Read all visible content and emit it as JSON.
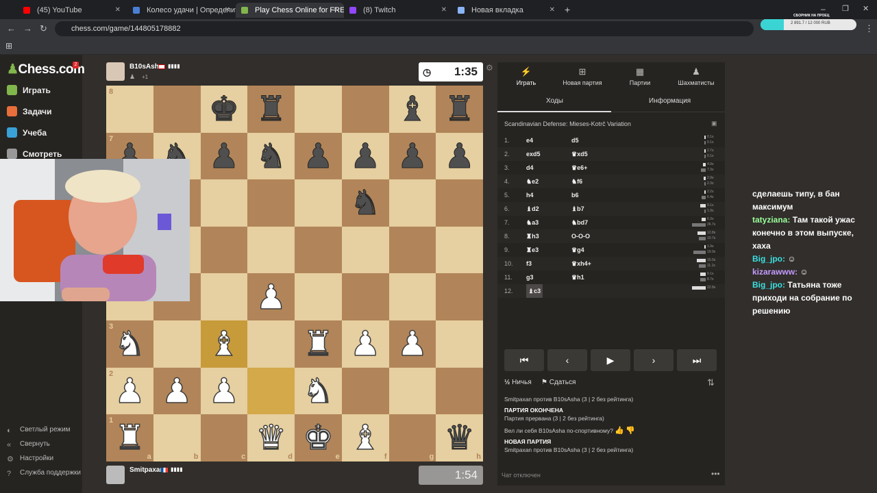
{
  "browser": {
    "tabs": [
      {
        "title": "(45) YouTube",
        "color": "#ff0000"
      },
      {
        "title": "Колесо удачи | Определите п",
        "color": "#4a7fd6"
      },
      {
        "title": "Play Chess Online for FREE - 2 |",
        "color": "#81b64c"
      },
      {
        "title": "(8) Twitch",
        "color": "#9146ff"
      },
      {
        "title": "Новая вкладка",
        "color": "#8ab4f8"
      }
    ],
    "url": "chess.com/game/144805178882",
    "overlay_title": "СБОРНИК НА ПРОЕЦ",
    "overlay_progress_text": "2 891.7 / 12 000 RUB",
    "overlay_progress": 0.24
  },
  "sidebar": {
    "logo": "Chess.com",
    "badge": "2",
    "items": [
      {
        "label": "Играть",
        "color": "#81b64c"
      },
      {
        "label": "Задачи",
        "color": "#e86e3b"
      },
      {
        "label": "Учеба",
        "color": "#3aa0d8"
      },
      {
        "label": "Смотреть",
        "color": "#999999"
      }
    ],
    "footer": [
      "Светлый режим",
      "Свернуть",
      "Настройки",
      "Служба поддержки"
    ]
  },
  "players": {
    "top": {
      "name": "B10sAsha",
      "sub": "+1",
      "clock": "1:35"
    },
    "bottom": {
      "name": "Smitpaxan",
      "clock": "1:54"
    }
  },
  "board": {
    "rows": [
      "..kr..br",
      "pnpnpppp",
      ".....n..",
      "........",
      "...P....",
      "N.B.RPP.",
      "PPP.N...",
      "R..QKB.q"
    ],
    "ranks": [
      "8",
      "7",
      "6",
      "5",
      "4",
      "3",
      "2",
      "1"
    ],
    "files": [
      "a",
      "b",
      "c",
      "d",
      "e",
      "f",
      "g",
      "h"
    ]
  },
  "panel": {
    "tabs": [
      "Играть",
      "Новая партия",
      "Партии",
      "Шахматисты"
    ],
    "subtabs": [
      "Ходы",
      "Информация"
    ],
    "opening": "Scandinavian Defense: Mieses-Kotrč Variation",
    "moves": [
      {
        "n": "1.",
        "w": "e4",
        "b": "d5"
      },
      {
        "n": "2.",
        "w": "exd5",
        "b": "♛xd5"
      },
      {
        "n": "3.",
        "w": "d4",
        "b": "♛e6+"
      },
      {
        "n": "4.",
        "w": "♞e2",
        "b": "♞f6"
      },
      {
        "n": "5.",
        "w": "h4",
        "b": "b6"
      },
      {
        "n": "6.",
        "w": "♝d2",
        "b": "♝b7"
      },
      {
        "n": "7.",
        "w": "♞a3",
        "b": "♞bd7"
      },
      {
        "n": "8.",
        "w": "♜h3",
        "b": "O-O-O"
      },
      {
        "n": "9.",
        "w": "♜e3",
        "b": "♛g4"
      },
      {
        "n": "10.",
        "w": "f3",
        "b": "♛xh4+"
      },
      {
        "n": "11.",
        "w": "g3",
        "b": "♛h1"
      },
      {
        "n": "12.",
        "w": "♝c3",
        "b": ""
      }
    ],
    "times": [
      [
        "0.1s",
        "0.1s"
      ],
      [
        "2.7s",
        "0.1s"
      ],
      [
        "4.9s",
        "7.3s"
      ],
      [
        "2.9s",
        "2.3s"
      ],
      [
        "2.2s",
        "6.4s"
      ],
      [
        "9.1s",
        "1.9s"
      ],
      [
        "6.3s",
        "26.7s"
      ],
      [
        "12.8s",
        "10.7s"
      ],
      [
        "1.9s",
        "19.9s"
      ],
      [
        "15.0s",
        "11.1s"
      ],
      [
        "9.1s",
        "8.7s"
      ],
      [
        "22.8s",
        ""
      ]
    ],
    "draw": "Ничья",
    "resign": "Сдаться",
    "chat": [
      {
        "t": "Smitpaxan против B10sAsha (3 | 2 без рейтинга)",
        "bold": false
      },
      {
        "t": "ПАРТИЯ ОКОНЧЕНА",
        "bold": true
      },
      {
        "t": "Партия прервана (3 | 2 без рейтинга)",
        "bold": false
      },
      {
        "t": "Вел ли себя B10sAsha по-спортивному?",
        "bold": false
      },
      {
        "t": "НОВАЯ ПАРТИЯ",
        "bold": true
      },
      {
        "t": "Smitpaxan против B10sAsha (3 | 2 без рейтинга)",
        "bold": false
      }
    ],
    "chat_off": "Чат отключен"
  },
  "stream_chat": [
    {
      "user": "",
      "msg": "сделаешь типу, в бан максимум"
    },
    {
      "user": "tatyziana",
      "msg": "Там такой ужас конечно в этом выпуске, хаха"
    },
    {
      "user": "Big_jpo",
      "msg": "☺"
    },
    {
      "user": "kizarawww",
      "msg": "☺"
    },
    {
      "user": "Big_jpo",
      "msg": "Татьяна тоже приходи на собрание по решению"
    }
  ]
}
